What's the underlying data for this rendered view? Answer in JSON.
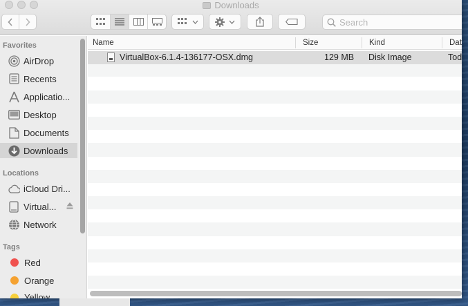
{
  "window": {
    "title": "Downloads"
  },
  "toolbar": {
    "back_icon": "chevron-left-icon",
    "forward_icon": "chevron-right-icon",
    "view_modes": [
      "icon-view-icon",
      "list-view-icon",
      "column-view-icon",
      "gallery-view-icon"
    ],
    "active_view": "list",
    "group_icon": "group-by-icon",
    "action_icon": "gear-icon",
    "share_icon": "share-icon",
    "tag_icon": "tag-icon"
  },
  "search": {
    "placeholder": "Search",
    "value": ""
  },
  "sidebar": {
    "favorites_header": "Favorites",
    "favorites": [
      {
        "label": "AirDrop",
        "icon": "airdrop-icon"
      },
      {
        "label": "Recents",
        "icon": "recents-icon"
      },
      {
        "label": "Applicatio...",
        "icon": "applications-icon"
      },
      {
        "label": "Desktop",
        "icon": "desktop-icon"
      },
      {
        "label": "Documents",
        "icon": "documents-icon"
      },
      {
        "label": "Downloads",
        "icon": "downloads-icon",
        "selected": true
      }
    ],
    "locations_header": "Locations",
    "locations": [
      {
        "label": "iCloud Dri...",
        "icon": "icloud-icon"
      },
      {
        "label": "Virtual...",
        "icon": "disk-icon",
        "ejectable": true
      },
      {
        "label": "Network",
        "icon": "network-icon"
      }
    ],
    "tags_header": "Tags",
    "tags": [
      {
        "label": "Red",
        "color": "#f0524f"
      },
      {
        "label": "Orange",
        "color": "#f5a231"
      },
      {
        "label": "Yellow",
        "color": "#f7d03c"
      }
    ]
  },
  "list": {
    "columns": {
      "name": "Name",
      "size": "Size",
      "kind": "Kind",
      "date": "Date"
    },
    "files": [
      {
        "name": "VirtualBox-6.1.4-136177-OSX.dmg",
        "size": "129 MB",
        "kind": "Disk Image",
        "date": "Tod"
      }
    ]
  }
}
